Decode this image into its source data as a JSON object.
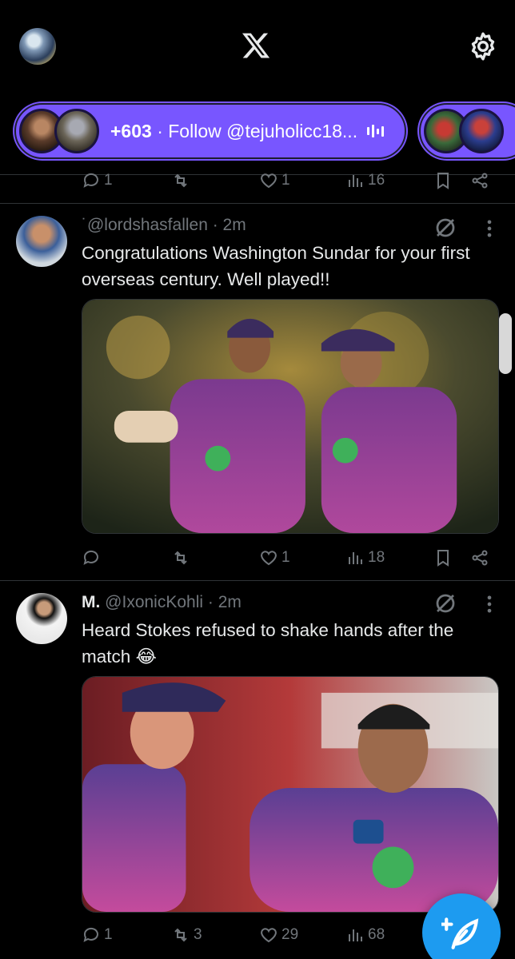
{
  "app": {
    "logo_icon": "x-logo-icon",
    "settings_icon": "gear-icon",
    "accent": "#1d9bf0",
    "spaces_color": "#7856ff"
  },
  "spaces": {
    "primary": {
      "count": "+603",
      "text": " · Follow @tejuholicc18...",
      "icon": "live-audio-icon"
    },
    "secondary": {
      "count": "+"
    }
  },
  "previous_tweet": {
    "replies": "1",
    "reposts": "",
    "likes": "1",
    "views": "16"
  },
  "tweets": [
    {
      "display_name": "",
      "handle": "˙@lordshasfallen",
      "time": " · 2m",
      "text": "Congratulations Washington Sundar for your first overseas century. Well played!!",
      "replies": "",
      "reposts": "",
      "likes": "1",
      "views": "18"
    },
    {
      "display_name": "M.",
      "handle": " @IxonicKohli",
      "time": " · 2m",
      "text": "Heard Stokes refused to shake hands after the match 😂",
      "replies": "1",
      "reposts": "3",
      "likes": "29",
      "views": "68"
    }
  ],
  "compose": {
    "icon": "compose-feather-icon"
  }
}
